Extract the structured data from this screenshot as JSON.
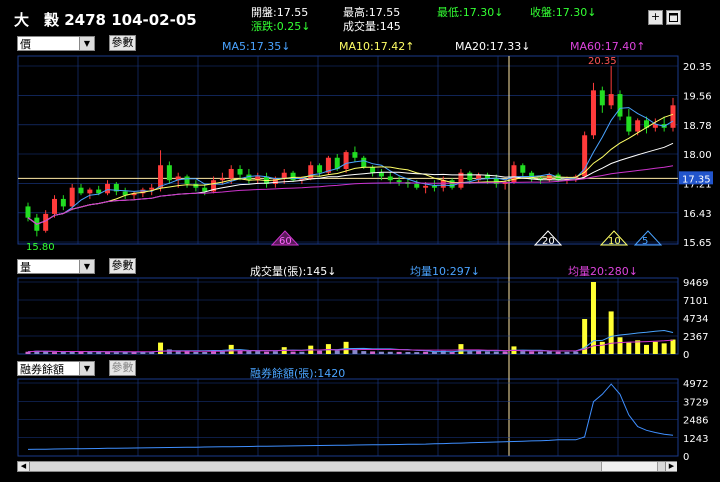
{
  "header": {
    "title": "大　穀 2478 104-02-05",
    "open": "開盤:17.55",
    "high": "最高:17.55",
    "low": "最低:17.30↓",
    "close": "收盤:17.30↓",
    "change": "漲跌:0.25↓",
    "volume": "成交量:145",
    "zoom_in_label": "+",
    "window_icon": "window-icon"
  },
  "price_panel": {
    "select_value": "價",
    "param_button": "參數",
    "ma5": "MA5:17.35↓",
    "ma10": "MA10:17.42↑",
    "ma20": "MA20:17.33↓",
    "ma60": "MA60:17.40↑",
    "peak_label": "20.35",
    "low_label": "15.80",
    "yticks": [
      "20.35",
      "19.56",
      "18.78",
      "18.00",
      "17.21",
      "16.43",
      "15.65"
    ],
    "current_price": "17.35",
    "markers": [
      "60",
      "20",
      "10",
      "5"
    ]
  },
  "volume_panel": {
    "select_value": "量",
    "param_button": "參數",
    "vol": "成交量(張):145↓",
    "avg10": "均量10:297↓",
    "avg20": "均量20:280↓",
    "yticks": [
      "9469",
      "7101",
      "4734",
      "2367",
      "0"
    ]
  },
  "margin_panel": {
    "select_value": "融券餘額",
    "param_button": "參數",
    "value": "融券餘額(張):1420",
    "yticks": [
      "4972",
      "3729",
      "2486",
      "1243",
      "0"
    ]
  },
  "colors": {
    "up": "#ff3b3b",
    "down": "#22dd22",
    "ma5": "#4aa3ff",
    "ma10": "#ffff66",
    "ma20": "#ffffff",
    "ma60": "#cc33cc",
    "grid": "#1a3a8a",
    "green_text": "#33ff33"
  },
  "chart_data": {
    "type": "candlestick",
    "ohlc": [
      [
        16.6,
        16.7,
        16.2,
        16.3
      ],
      [
        16.3,
        16.4,
        15.8,
        15.95
      ],
      [
        15.95,
        16.5,
        15.9,
        16.4
      ],
      [
        16.4,
        16.9,
        16.3,
        16.8
      ],
      [
        16.8,
        16.9,
        16.5,
        16.6
      ],
      [
        16.6,
        17.2,
        16.5,
        17.1
      ],
      [
        17.1,
        17.2,
        16.9,
        16.95
      ],
      [
        16.95,
        17.1,
        16.8,
        17.05
      ],
      [
        17.05,
        17.15,
        16.9,
        16.95
      ],
      [
        16.95,
        17.3,
        16.9,
        17.2
      ],
      [
        17.2,
        17.25,
        16.9,
        17.0
      ],
      [
        17.0,
        17.1,
        16.8,
        16.9
      ],
      [
        16.9,
        17.0,
        16.8,
        16.95
      ],
      [
        16.95,
        17.1,
        16.85,
        17.05
      ],
      [
        17.05,
        17.2,
        16.9,
        17.1
      ],
      [
        17.1,
        18.1,
        17.0,
        17.7
      ],
      [
        17.7,
        17.8,
        17.2,
        17.3
      ],
      [
        17.3,
        17.5,
        17.1,
        17.4
      ],
      [
        17.4,
        17.45,
        17.1,
        17.2
      ],
      [
        17.2,
        17.3,
        17.0,
        17.1
      ],
      [
        17.1,
        17.2,
        16.9,
        17.0
      ],
      [
        17.0,
        17.4,
        16.95,
        17.3
      ],
      [
        17.3,
        17.5,
        17.2,
        17.35
      ],
      [
        17.35,
        17.7,
        17.2,
        17.6
      ],
      [
        17.6,
        17.7,
        17.3,
        17.45
      ],
      [
        17.45,
        17.6,
        17.2,
        17.3
      ],
      [
        17.3,
        17.5,
        17.2,
        17.4
      ],
      [
        17.4,
        17.5,
        17.1,
        17.2
      ],
      [
        17.2,
        17.4,
        17.1,
        17.35
      ],
      [
        17.35,
        17.6,
        17.2,
        17.5
      ],
      [
        17.5,
        17.55,
        17.25,
        17.3
      ],
      [
        17.3,
        17.4,
        17.2,
        17.35
      ],
      [
        17.35,
        17.8,
        17.3,
        17.7
      ],
      [
        17.7,
        17.75,
        17.4,
        17.5
      ],
      [
        17.5,
        17.95,
        17.45,
        17.9
      ],
      [
        17.9,
        18.0,
        17.55,
        17.6
      ],
      [
        17.6,
        18.1,
        17.5,
        18.05
      ],
      [
        18.05,
        18.2,
        17.8,
        17.9
      ],
      [
        17.9,
        17.95,
        17.6,
        17.65
      ],
      [
        17.65,
        17.7,
        17.4,
        17.5
      ],
      [
        17.5,
        17.6,
        17.3,
        17.4
      ],
      [
        17.4,
        17.5,
        17.2,
        17.3
      ],
      [
        17.3,
        17.4,
        17.15,
        17.25
      ],
      [
        17.25,
        17.35,
        17.1,
        17.2
      ],
      [
        17.2,
        17.3,
        17.05,
        17.1
      ],
      [
        17.1,
        17.25,
        16.95,
        17.15
      ],
      [
        17.15,
        17.3,
        17.0,
        17.1
      ],
      [
        17.1,
        17.4,
        17.0,
        17.3
      ],
      [
        17.3,
        17.35,
        17.05,
        17.1
      ],
      [
        17.1,
        17.6,
        17.05,
        17.5
      ],
      [
        17.5,
        17.55,
        17.2,
        17.3
      ],
      [
        17.3,
        17.5,
        17.25,
        17.45
      ],
      [
        17.45,
        17.5,
        17.2,
        17.35
      ],
      [
        17.35,
        17.45,
        17.1,
        17.2
      ],
      [
        17.2,
        17.3,
        17.05,
        17.25
      ],
      [
        17.25,
        17.8,
        17.2,
        17.7
      ],
      [
        17.7,
        17.75,
        17.4,
        17.5
      ],
      [
        17.5,
        17.55,
        17.25,
        17.35
      ],
      [
        17.35,
        17.4,
        17.2,
        17.3
      ],
      [
        17.3,
        17.5,
        17.25,
        17.45
      ],
      [
        17.45,
        17.5,
        17.25,
        17.3
      ],
      [
        17.3,
        17.4,
        17.2,
        17.35
      ],
      [
        17.35,
        17.45,
        17.25,
        17.4
      ],
      [
        17.4,
        18.6,
        17.35,
        18.5
      ],
      [
        18.5,
        19.9,
        18.4,
        19.7
      ],
      [
        19.7,
        19.8,
        19.1,
        19.3
      ],
      [
        19.3,
        20.35,
        19.2,
        19.6
      ],
      [
        19.6,
        19.7,
        18.9,
        19.0
      ],
      [
        19.0,
        19.2,
        18.5,
        18.6
      ],
      [
        18.6,
        18.95,
        18.5,
        18.9
      ],
      [
        18.9,
        19.0,
        18.55,
        18.7
      ],
      [
        18.7,
        18.95,
        18.6,
        18.8
      ],
      [
        18.8,
        19.0,
        18.6,
        18.7
      ],
      [
        18.7,
        19.5,
        18.6,
        19.3
      ]
    ],
    "volume_ymax": 9469,
    "margin_ymax": 4972,
    "price_ylim": [
      15.65,
      20.35
    ]
  }
}
